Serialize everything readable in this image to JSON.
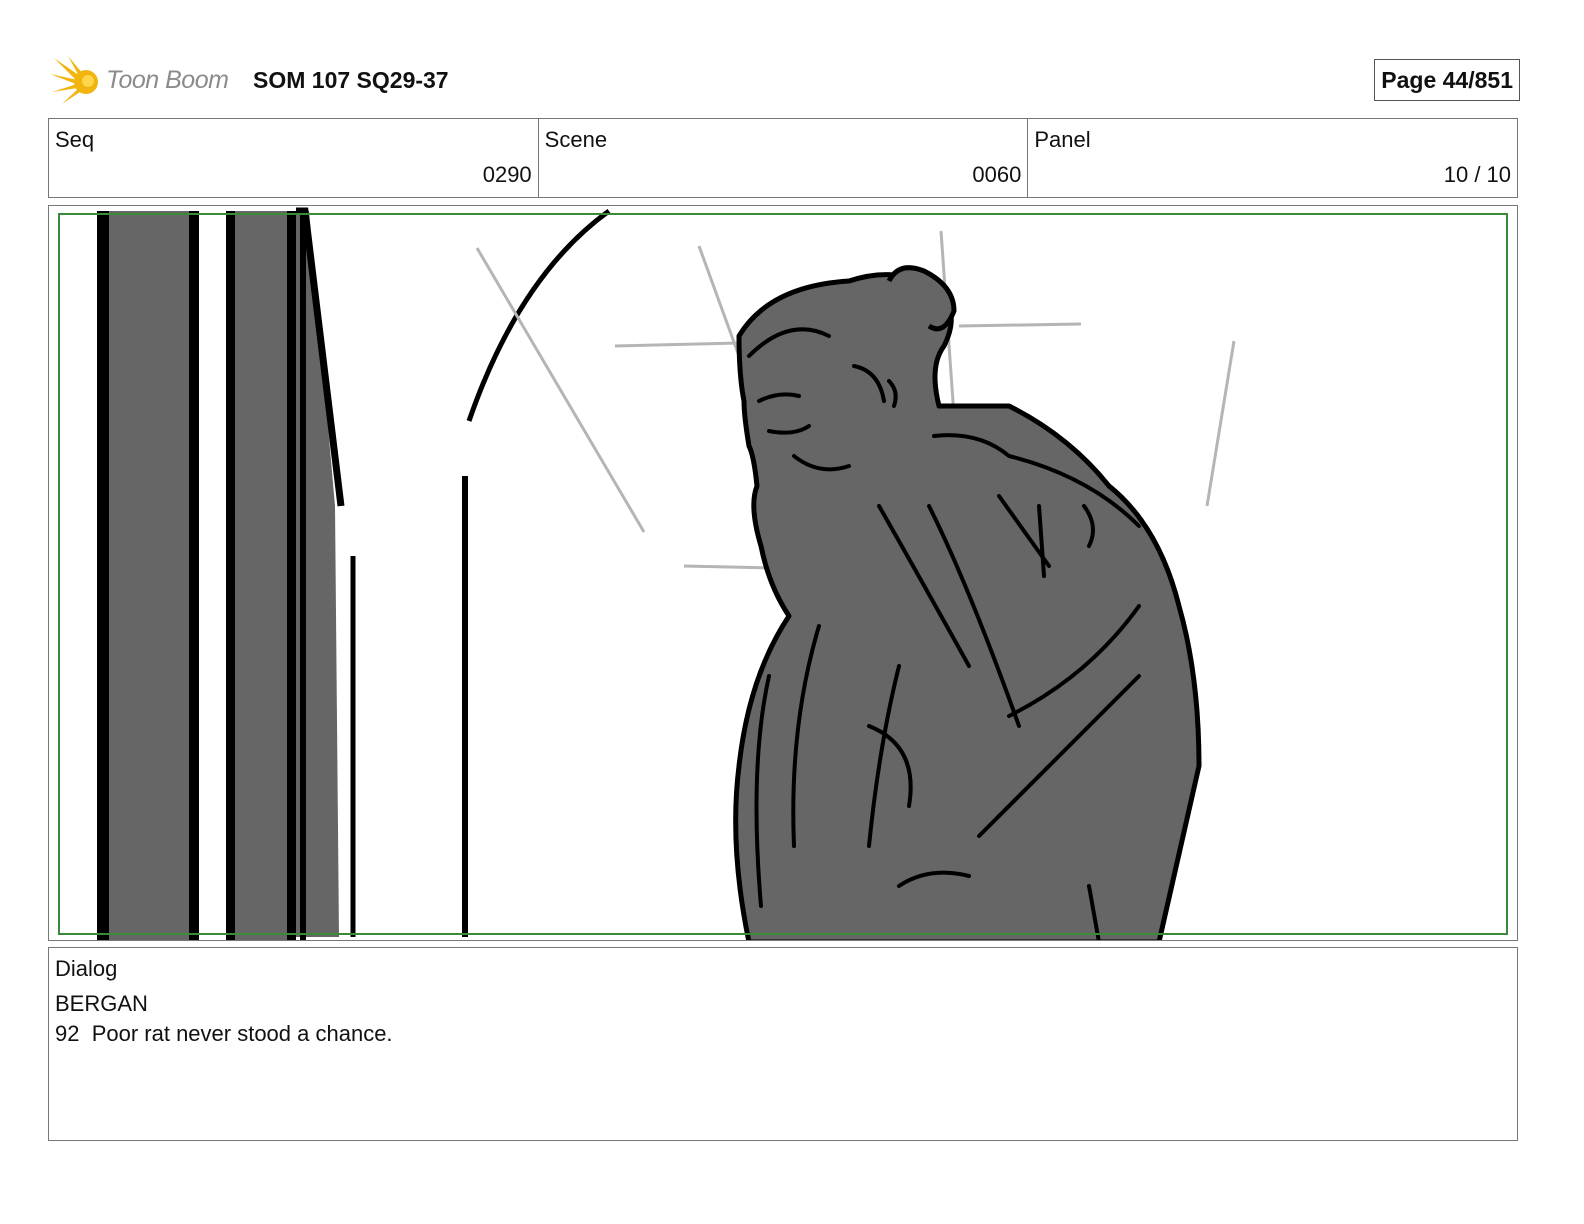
{
  "header": {
    "logo_text": "Toon Boom",
    "logo_icon": "starburst-logo-icon",
    "doc_title": "SOM 107 SQ29-37",
    "page_label": "Page",
    "page_value": "44/851"
  },
  "info": {
    "seq_label": "Seq",
    "seq_value": "0290",
    "scene_label": "Scene",
    "scene_value": "0060",
    "panel_label": "Panel",
    "panel_value": "10 / 10"
  },
  "panel": {
    "safe_frame_color": "#3a8a3a",
    "fill_color": "#666666",
    "line_color": "#000000",
    "guide_color": "#b5b5b5"
  },
  "dialog": {
    "label": "Dialog",
    "speaker": "BERGAN",
    "line": "92  Poor rat never stood a chance."
  }
}
